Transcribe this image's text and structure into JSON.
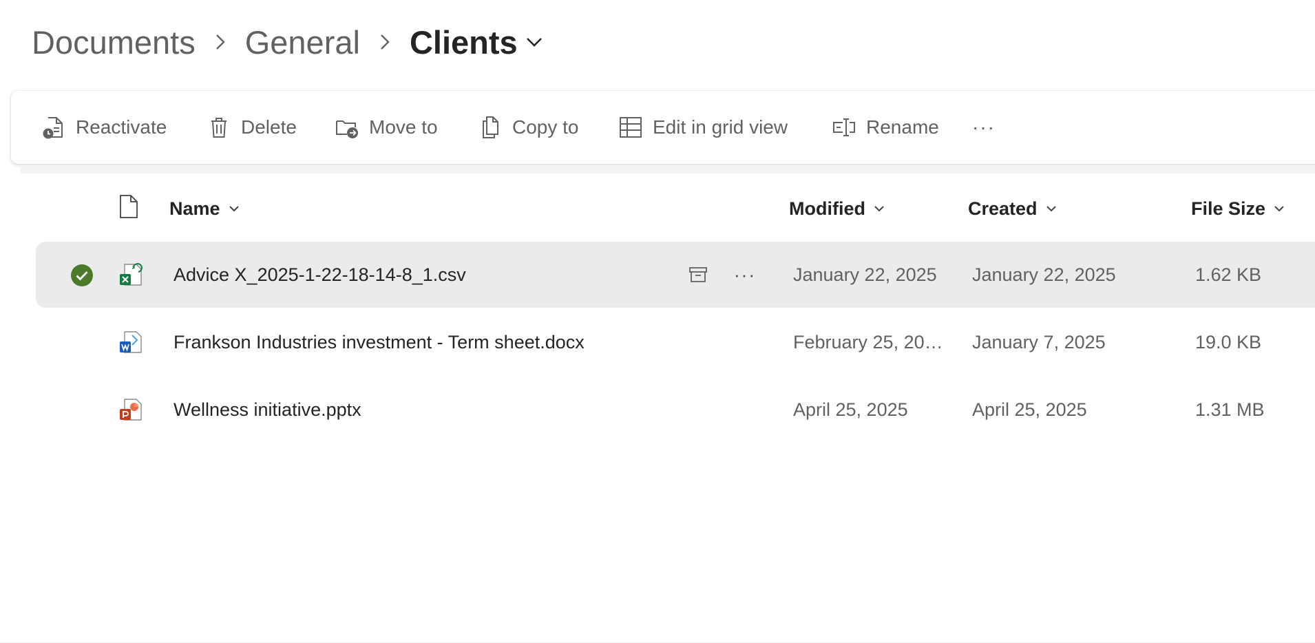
{
  "breadcrumb": {
    "items": [
      "Documents",
      "General"
    ],
    "current": "Clients"
  },
  "commands": {
    "reactivate": "Reactivate",
    "delete": "Delete",
    "move_to": "Move to",
    "copy_to": "Copy to",
    "edit_grid": "Edit in grid view",
    "rename": "Rename",
    "more": "···"
  },
  "columns": {
    "name": "Name",
    "modified": "Modified",
    "created": "Created",
    "file_size": "File Size"
  },
  "files": [
    {
      "name": "Advice X_2025-1-22-18-14-8_1.csv",
      "modified": "January 22, 2025",
      "created": "January 22, 2025",
      "size": "1.62 KB",
      "type_icon": "excel-file-icon",
      "selected": true
    },
    {
      "name": "Frankson Industries investment - Term sheet.docx",
      "modified": "February 25, 20…",
      "created": "January 7, 2025",
      "size": "19.0 KB",
      "type_icon": "word-file-icon",
      "selected": false
    },
    {
      "name": "Wellness initiative.pptx",
      "modified": "April 25, 2025",
      "created": "April 25, 2025",
      "size": "1.31 MB",
      "type_icon": "powerpoint-file-icon",
      "selected": false
    }
  ],
  "row_more": "···",
  "colors": {
    "selected_row": "#ebebeb",
    "check_green": "#4b7a2a",
    "excel": "#107c41",
    "word": "#185abd",
    "powerpoint": "#c43e1c",
    "text_secondary": "#616161"
  }
}
